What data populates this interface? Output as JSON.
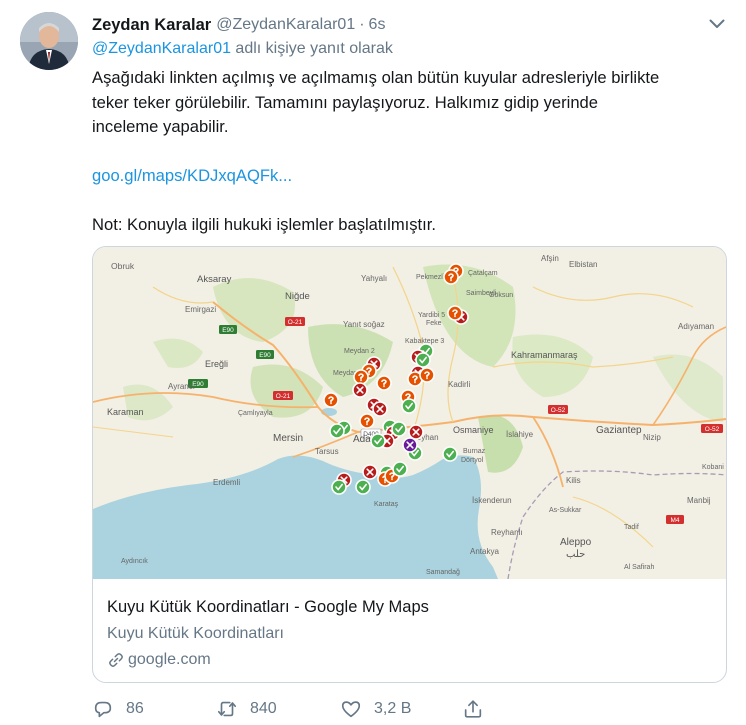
{
  "tweet": {
    "display_name": "Zeydan Karalar",
    "handle": "@ZeydanKaralar01",
    "separator": "·",
    "time": "6s",
    "reply_mention": "@ZeydanKaralar01",
    "reply_suffix": " adlı kişiye yanıt olarak",
    "body_lines": [
      "Aşağıdaki linkten açılmış ve açılmamış olan bütün kuyular adresleriyle birlikte",
      "teker teker görülebilir. Tamamını paylaşıyoruz. Halkımız gidip yerinde",
      "inceleme yapabilir."
    ],
    "link_text": "goo.gl/maps/KDJxqAQFk...",
    "note": "Not: Konuyla ilgili hukuki işlemler başlatılmıştır."
  },
  "card": {
    "title": "Kuyu Kütük Koordinatları - Google My Maps",
    "description": "Kuyu Kütük Koordinatları",
    "domain": "google.com",
    "map_labels": {
      "obruk": "Obruk",
      "aksaray": "Aksaray",
      "emirgazi": "Emirgazi",
      "nigde": "Niğde",
      "yahyali": "Yahyalı",
      "yanitoglu": "Yanıt soğaz",
      "pekmezli": "Pekmezli",
      "catalcam": "Çatalçam",
      "saimbeyli": "Saimbeyli",
      "goksun": "Göksun",
      "afsin": "Afşin",
      "elbistan": "Elbistan",
      "yardibi": "Yardibi 5",
      "feke": "Feke",
      "adiyaman": "Adıyaman",
      "kabaktepe": "Kabaktepe 3",
      "meydan2": "Meydan 2",
      "meydan1": "Meydan 1",
      "kahramanmaras": "Kahramanmaraş",
      "eregli": "Ereğli",
      "kadirli": "Kadirli",
      "ayranci": "Ayrancı",
      "camliyayla": "Çamlıyayla",
      "karaman": "Karaman",
      "osmaniye": "Osmaniye",
      "islahiye": "İslahiye",
      "gaziantep": "Gaziantep",
      "nizip": "Nizip",
      "adana": "Adana",
      "ceyhan": "Ceyhan",
      "burnaz": "Burnaz",
      "dortyol": "Dörtyol",
      "mersin": "Mersin",
      "tarsus": "Tarsus",
      "kilis": "Kilis",
      "kobani": "Kobani",
      "manbij": "Manbij",
      "karatas": "Karataş",
      "iskenderun": "İskenderun",
      "erdemli": "Erdemli",
      "reyhanli": "Reyhanlı",
      "aleppo": "Aleppo",
      "aleppo_ar": "حلب",
      "antakya": "Antakya",
      "samandag": "Samandağ",
      "aydincik": "Aydıncık",
      "siria": "Al Safirah",
      "tadif": "Tadif",
      "as_sukkar": "As-Sukkar",
      "e90a": "E90",
      "e90b": "E90",
      "e90c": "E90",
      "o21a": "O-21",
      "o21b": "O-21",
      "d400": "D400",
      "o52a": "O-52",
      "o52b": "O-52",
      "m4": "M4"
    }
  },
  "actions": {
    "replies": "86",
    "retweets": "840",
    "likes": "3,2 B"
  },
  "colors": {
    "accent": "#1b95e0",
    "secondary_text": "#657786",
    "marker_green": "#4caf50",
    "marker_red": "#b71c1c",
    "marker_orange": "#e65100"
  }
}
